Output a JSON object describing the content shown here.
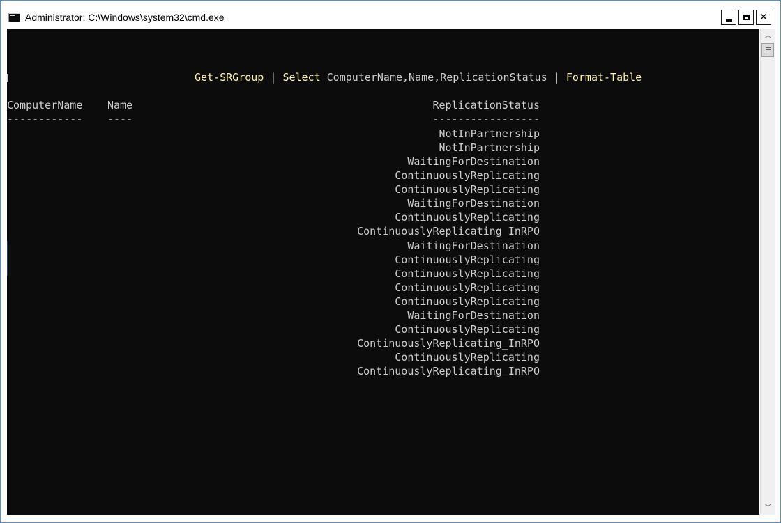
{
  "window": {
    "title": "Administrator: C:\\Windows\\system32\\cmd.exe",
    "icon": "cmd-app-icon",
    "controls": {
      "minimize_icon": "minimize-icon",
      "maximize_icon": "maximize-icon",
      "close_glyph": "✕"
    }
  },
  "console": {
    "command": {
      "part1": "Get-SRGroup",
      "pipe1": " | ",
      "select": "Select",
      "args": " ComputerName,Name,ReplicationStatus",
      "pipe2": " | ",
      "format": "Format-Table"
    },
    "table": {
      "headers": [
        "ComputerName",
        "Name",
        "ReplicationStatus"
      ],
      "separators": [
        "------------",
        "----",
        "-----------------"
      ],
      "rows": [
        "NotInPartnership",
        "NotInPartnership",
        "WaitingForDestination",
        "ContinuouslyReplicating",
        "ContinuouslyReplicating",
        "WaitingForDestination",
        "ContinuouslyReplicating",
        "ContinuouslyReplicating_InRPO",
        "WaitingForDestination",
        "ContinuouslyReplicating",
        "ContinuouslyReplicating",
        "ContinuouslyReplicating",
        "ContinuouslyReplicating",
        "WaitingForDestination",
        "ContinuouslyReplicating",
        "ContinuouslyReplicating_InRPO",
        "ContinuouslyReplicating",
        "ContinuouslyReplicating_InRPO"
      ]
    }
  },
  "scrollbar": {
    "up_glyph": "︿",
    "down_glyph": "﹀"
  },
  "colors": {
    "console_bg": "#0c0c0c",
    "console_text": "#cccccc",
    "command_text": "#f9f1a5"
  }
}
